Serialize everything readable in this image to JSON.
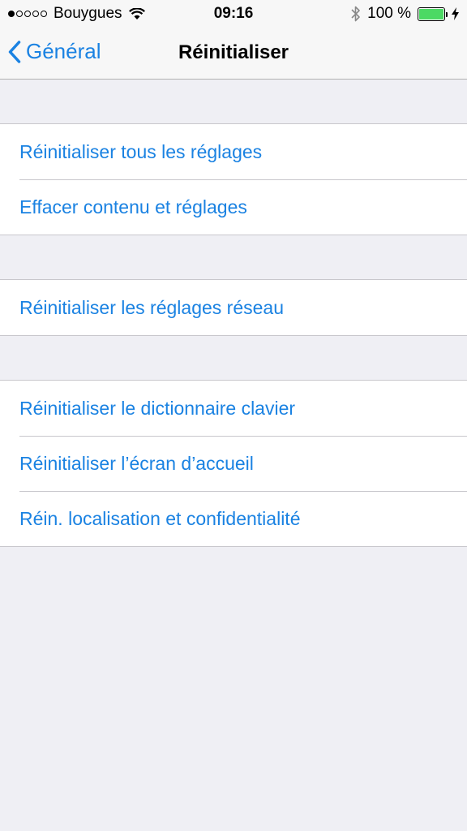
{
  "status_bar": {
    "carrier": "Bouygues",
    "signal_bars_filled": 1,
    "signal_bars_total": 5,
    "time": "09:16",
    "battery_percent": "100 %",
    "battery_color": "#4cd964",
    "icons": [
      "wifi-icon",
      "bluetooth-icon",
      "battery-icon",
      "charging-bolt-icon"
    ]
  },
  "nav": {
    "back_label": "Général",
    "title": "Réinitialiser",
    "accent_color": "#1a82e2"
  },
  "groups": [
    {
      "items": [
        {
          "label": "Réinitialiser tous les réglages"
        },
        {
          "label": "Effacer contenu et réglages"
        }
      ]
    },
    {
      "items": [
        {
          "label": "Réinitialiser les réglages réseau"
        }
      ]
    },
    {
      "items": [
        {
          "label": "Réinitialiser le dictionnaire clavier"
        },
        {
          "label": "Réinitialiser l’écran d’accueil"
        },
        {
          "label": "Réin. localisation et confidentialité"
        }
      ]
    }
  ]
}
